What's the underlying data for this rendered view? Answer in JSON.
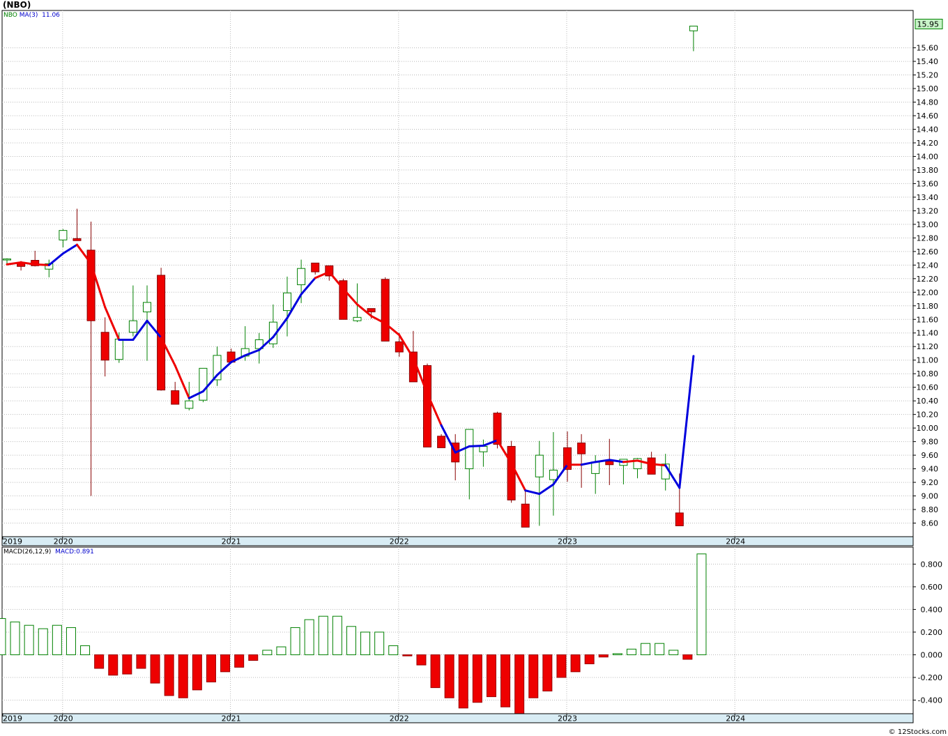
{
  "title": "(NBO)",
  "legend": {
    "ticker": "NBO",
    "ma_label": "MA(3)",
    "ma_value": "11.06",
    "macd_label": "MACD(26,12,9)",
    "macd_value": "MACD:0.891"
  },
  "last_price_label": "15.95",
  "credit": "© 12Stocks.com",
  "colors": {
    "up": "#ffffff",
    "up_border": "#008000",
    "down": "#ee0000",
    "ma_up": "#0000dd",
    "ma_down": "#ee0000",
    "axis_band": "#d8ecf4"
  },
  "chart_data": [
    {
      "type": "candlestick",
      "title": "(NBO)",
      "x_labels": [
        "2019",
        "2020",
        "2021",
        "2022",
        "2023",
        "2024"
      ],
      "y_ticks": [
        "8.60",
        "8.80",
        "9.00",
        "9.20",
        "9.40",
        "9.60",
        "9.80",
        "10.00",
        "10.20",
        "10.40",
        "10.60",
        "10.80",
        "11.00",
        "11.20",
        "11.40",
        "11.60",
        "11.80",
        "12.00",
        "12.20",
        "12.40",
        "12.60",
        "12.80",
        "13.00",
        "13.20",
        "13.40",
        "13.60",
        "13.80",
        "14.00",
        "14.20",
        "14.40",
        "14.60",
        "14.80",
        "15.00",
        "15.20",
        "15.40",
        "15.60"
      ],
      "ylim": [
        8.4,
        16.15
      ],
      "grid": true,
      "periods": [
        "2019-12",
        "2020-01",
        "2020-02",
        "2020-03",
        "2020-04",
        "2020-05",
        "2020-06",
        "2020-07",
        "2020-08",
        "2020-09",
        "2020-10",
        "2020-11",
        "2020-12",
        "2021-01",
        "2021-02",
        "2021-03",
        "2021-04",
        "2021-05",
        "2021-06",
        "2021-07",
        "2021-08",
        "2021-09",
        "2021-10",
        "2021-11",
        "2021-12",
        "2022-01",
        "2022-02",
        "2022-03",
        "2022-04",
        "2022-05",
        "2022-06",
        "2022-07",
        "2022-08",
        "2022-09",
        "2022-10",
        "2022-11",
        "2022-12",
        "2023-01",
        "2023-02",
        "2023-03",
        "2023-04",
        "2023-05",
        "2023-06",
        "2023-07",
        "2023-08",
        "2023-09",
        "2023-10",
        "2023-11",
        "2023-12",
        "2024-01"
      ],
      "open": [
        12.48,
        12.44,
        12.47,
        12.34,
        12.77,
        12.79,
        12.62,
        11.41,
        11.01,
        11.41,
        11.71,
        12.25,
        10.55,
        10.29,
        10.41,
        10.71,
        11.12,
        11.06,
        11.17,
        11.24,
        11.73,
        12.11,
        12.43,
        12.39,
        12.17,
        11.58,
        11.76,
        12.19,
        11.27,
        11.12,
        10.92,
        9.88,
        9.78,
        9.4,
        9.65,
        10.22,
        9.73,
        8.88,
        9.28,
        9.24,
        9.71,
        9.78,
        9.33,
        9.51,
        9.45,
        9.4,
        9.56,
        9.25,
        8.75,
        15.85
      ],
      "high": [
        12.5,
        12.46,
        12.61,
        12.48,
        12.93,
        13.23,
        13.04,
        11.63,
        11.41,
        12.1,
        12.1,
        12.36,
        10.68,
        10.68,
        10.81,
        11.2,
        11.17,
        11.5,
        11.4,
        11.82,
        12.23,
        12.48,
        12.43,
        12.39,
        12.2,
        12.13,
        11.76,
        12.22,
        11.4,
        11.43,
        10.95,
        9.91,
        9.91,
        9.83,
        9.83,
        10.24,
        9.81,
        9.07,
        9.81,
        9.94,
        9.95,
        9.91,
        9.6,
        9.84,
        9.47,
        9.56,
        9.65,
        9.62,
        9.33,
        15.9
      ],
      "low": [
        12.41,
        12.32,
        12.38,
        12.22,
        12.66,
        12.76,
        9.0,
        10.76,
        10.96,
        11.35,
        10.99,
        10.55,
        10.5,
        10.26,
        10.38,
        10.62,
        10.96,
        10.99,
        10.95,
        11.18,
        11.35,
        11.84,
        12.26,
        12.17,
        12.15,
        11.56,
        11.61,
        11.85,
        11.05,
        10.9,
        10.46,
        9.72,
        9.23,
        8.95,
        9.43,
        9.7,
        8.9,
        8.71,
        8.56,
        8.71,
        9.21,
        9.12,
        9.03,
        9.16,
        9.17,
        9.26,
        9.38,
        9.08,
        8.69,
        15.55
      ],
      "close": [
        12.49,
        12.38,
        12.39,
        12.42,
        12.91,
        12.76,
        11.58,
        11.0,
        11.31,
        11.58,
        11.85,
        10.56,
        10.35,
        10.4,
        10.88,
        11.07,
        10.97,
        11.17,
        11.3,
        11.56,
        11.99,
        12.35,
        12.3,
        12.24,
        11.6,
        11.63,
        11.71,
        11.28,
        11.12,
        10.68,
        9.72,
        9.71,
        9.5,
        9.98,
        9.73,
        9.76,
        8.94,
        8.54,
        9.6,
        9.38,
        9.39,
        9.62,
        9.5,
        9.46,
        9.54,
        9.55,
        9.32,
        9.47,
        8.56,
        15.92
      ],
      "ma": [
        12.41,
        12.44,
        12.41,
        12.4,
        12.57,
        12.7,
        12.42,
        11.78,
        11.3,
        11.3,
        11.58,
        11.33,
        10.92,
        10.44,
        10.54,
        10.78,
        10.97,
        11.07,
        11.15,
        11.34,
        11.62,
        11.97,
        12.21,
        12.3,
        12.05,
        11.82,
        11.65,
        11.54,
        11.37,
        11.03,
        10.51,
        10.04,
        9.64,
        9.73,
        9.74,
        9.82,
        9.48,
        9.08,
        9.03,
        9.17,
        9.46,
        9.46,
        9.5,
        9.53,
        9.5,
        9.52,
        9.47,
        9.45,
        9.12,
        11.06
      ],
      "ma_color": [
        "up",
        "down",
        "down",
        "down",
        "up",
        "up",
        "down",
        "down",
        "down",
        "up",
        "up",
        "up",
        "down",
        "down",
        "up",
        "up",
        "up",
        "up",
        "up",
        "up",
        "up",
        "up",
        "up",
        "down",
        "down",
        "down",
        "down",
        "down",
        "down",
        "down",
        "down",
        "down",
        "up",
        "up",
        "up",
        "up",
        "down",
        "down",
        "up",
        "up",
        "up",
        "down",
        "up",
        "up",
        "up",
        "down",
        "down",
        "down",
        "up",
        "up"
      ]
    },
    {
      "type": "bar",
      "title": "MACD(26,12,9)",
      "series_name": "MACD",
      "x_labels": [
        "2019",
        "2020",
        "2021",
        "2022",
        "2023",
        "2024"
      ],
      "y_ticks": [
        "0.800",
        "0.600",
        "0.400",
        "0.200",
        "0.000",
        "-0.200",
        "-0.400"
      ],
      "ylim": [
        -0.52,
        0.95
      ],
      "values": [
        0.32,
        0.29,
        0.26,
        0.23,
        0.26,
        0.24,
        0.08,
        -0.12,
        -0.18,
        -0.17,
        -0.12,
        -0.25,
        -0.36,
        -0.38,
        -0.31,
        -0.24,
        -0.15,
        -0.11,
        -0.05,
        0.04,
        0.07,
        0.24,
        0.31,
        0.34,
        0.34,
        0.25,
        0.2,
        0.2,
        0.08,
        -0.01,
        -0.09,
        -0.29,
        -0.38,
        -0.47,
        -0.42,
        -0.37,
        -0.46,
        -0.52,
        -0.38,
        -0.32,
        -0.2,
        -0.15,
        -0.08,
        -0.02,
        0.01,
        0.05,
        0.1,
        0.1,
        0.04,
        -0.04,
        0.89
      ]
    }
  ]
}
